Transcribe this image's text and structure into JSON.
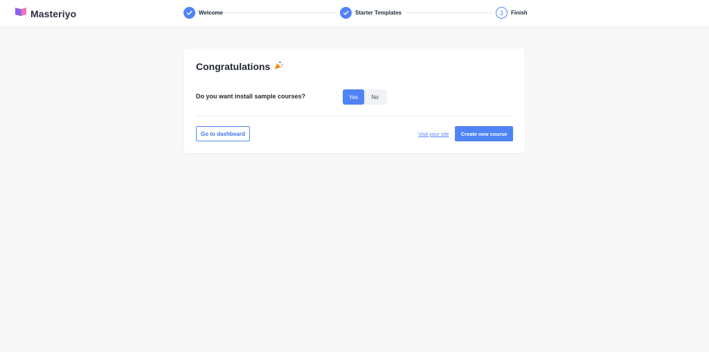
{
  "brand": {
    "name": "Masteriyo",
    "logo_icon": "open-book-icon",
    "accent": "#4f83f6"
  },
  "steps": [
    {
      "label": "Welcome",
      "state": "done",
      "icon": "check-icon"
    },
    {
      "label": "Starter Templates",
      "state": "done",
      "icon": "check-icon"
    },
    {
      "label": "Finish",
      "state": "current",
      "number": "3"
    }
  ],
  "card": {
    "title": "Congratulations",
    "title_icon": "party-popper-icon",
    "question": "Do you want install sample courses?",
    "toggle": {
      "yes_label": "Yes",
      "no_label": "No",
      "selected": "Yes"
    },
    "dashboard_button": "Go to dashboard",
    "visit_link": "Visit your site",
    "create_button": "Create new course"
  }
}
